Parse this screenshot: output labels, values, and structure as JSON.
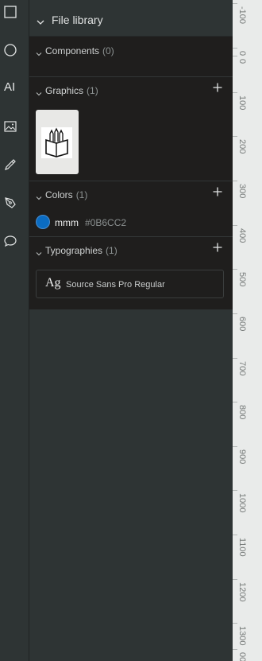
{
  "toolbar": {
    "tools": [
      {
        "name": "rectangle-icon",
        "label": "Rectangle"
      },
      {
        "name": "ellipse-icon",
        "label": "Ellipse"
      },
      {
        "name": "text-icon",
        "label": "Text"
      },
      {
        "name": "image-icon",
        "label": "Image"
      },
      {
        "name": "curve-icon",
        "label": "Curve"
      },
      {
        "name": "path-icon",
        "label": "Path"
      },
      {
        "name": "comments-icon",
        "label": "Comments"
      }
    ],
    "text_tool_glyph": "AI"
  },
  "library": {
    "title": "File library",
    "sections": {
      "components": {
        "label": "Components",
        "count": "(0)"
      },
      "graphics": {
        "label": "Graphics",
        "count": "(1)"
      },
      "colors": {
        "label": "Colors",
        "count": "(1)"
      },
      "typographies": {
        "label": "Typographies",
        "count": "(1)"
      }
    },
    "color_item": {
      "name": "mmm",
      "hex": "#0B6CC2",
      "swatch": "#0B6CC2"
    },
    "typography_item": {
      "preview": "Ag",
      "name": "Source Sans Pro Regular"
    }
  },
  "ruler": {
    "labels": [
      "-100",
      "0",
      "0",
      "100",
      "200",
      "300",
      "400",
      "500",
      "600",
      "700",
      "800",
      "900",
      "1000",
      "1100",
      "1200",
      "1300",
      "00"
    ]
  }
}
